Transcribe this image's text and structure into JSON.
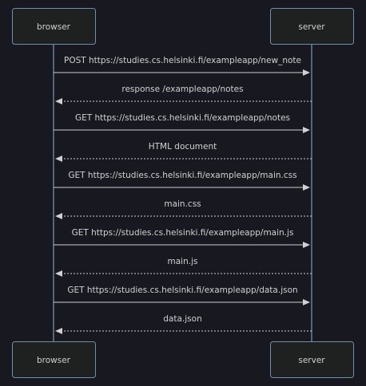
{
  "diagram": {
    "type": "sequence",
    "participants": [
      "browser",
      "server"
    ],
    "messages": [
      {
        "from": "browser",
        "to": "server",
        "text": "POST https://studies.cs.helsinki.fi/exampleapp/new_note",
        "style": "solid"
      },
      {
        "from": "server",
        "to": "browser",
        "text": "response /exampleapp/notes",
        "style": "dotted"
      },
      {
        "from": "browser",
        "to": "server",
        "text": "GET https://studies.cs.helsinki.fi/exampleapp/notes",
        "style": "solid"
      },
      {
        "from": "server",
        "to": "browser",
        "text": "HTML document",
        "style": "dotted"
      },
      {
        "from": "browser",
        "to": "server",
        "text": "GET https://studies.cs.helsinki.fi/exampleapp/main.css",
        "style": "solid"
      },
      {
        "from": "server",
        "to": "browser",
        "text": "main.css",
        "style": "dotted"
      },
      {
        "from": "browser",
        "to": "server",
        "text": "GET https://studies.cs.helsinki.fi/exampleapp/main.js",
        "style": "solid"
      },
      {
        "from": "server",
        "to": "browser",
        "text": "main.js",
        "style": "dotted"
      },
      {
        "from": "browser",
        "to": "server",
        "text": "GET https://studies.cs.helsinki.fi/exampleapp/data.json",
        "style": "solid"
      },
      {
        "from": "server",
        "to": "browser",
        "text": "data.json",
        "style": "dotted"
      }
    ],
    "colors": {
      "background": "#181920",
      "box_fill": "#1f2020",
      "box_border": "#6f8fae",
      "lifeline": "#8fb3d6",
      "arrow": "#d0d0d0",
      "text": "#d0d0d0"
    }
  }
}
